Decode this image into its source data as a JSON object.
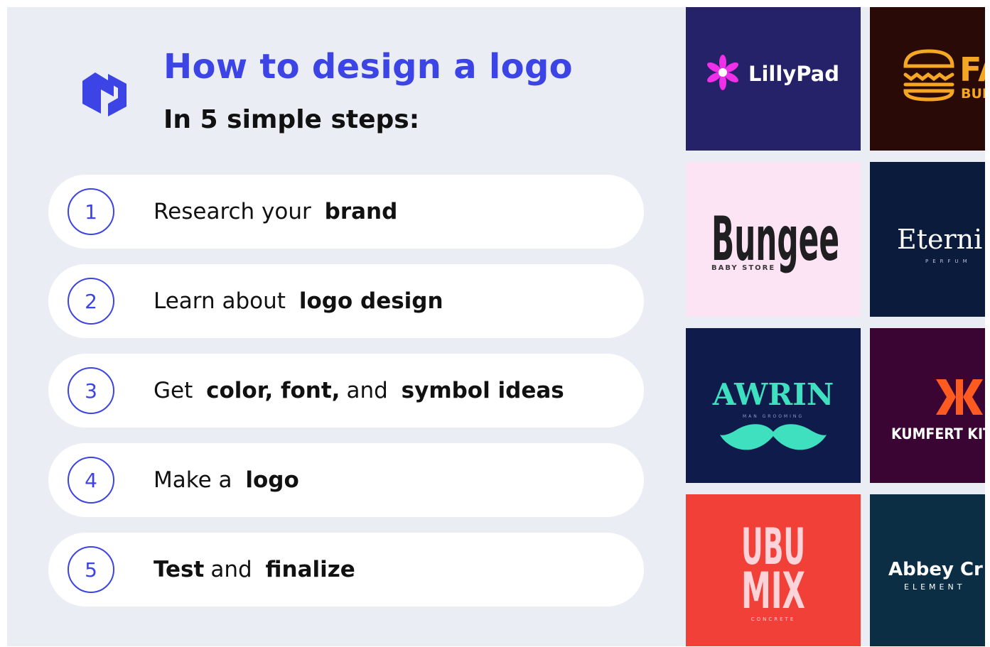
{
  "heading": {
    "title": "How to design a logo",
    "subtitle": "In 5 simple steps:"
  },
  "brand_icon": "hexagon-logo-icon",
  "steps": [
    {
      "number": "1",
      "parts": [
        "Research your",
        "brand"
      ]
    },
    {
      "number": "2",
      "parts": [
        "Learn about",
        "logo design"
      ]
    },
    {
      "number": "3",
      "parts": [
        "Get",
        "color, font,",
        "and",
        "symbol ideas"
      ]
    },
    {
      "number": "4",
      "parts": [
        "Make a",
        "logo"
      ]
    },
    {
      "number": "5",
      "parts": [
        "Test",
        "and",
        "finalize"
      ]
    }
  ],
  "logo_examples": {
    "lillypad": {
      "name": "LillyPad",
      "icon": "flower-icon"
    },
    "burger": {
      "name": "FA",
      "tagline": "BUR",
      "icon": "burger-icon"
    },
    "bungee": {
      "name": "Bungee",
      "tagline": "BABY STORE"
    },
    "eterni": {
      "name": "Eterni",
      "tagline": "PERFUM"
    },
    "awrin": {
      "name": "AWRIN",
      "tagline": "MAN GROOMING",
      "icon": "mustache-icon"
    },
    "kumfert": {
      "name": "KUMFERT KIT",
      "icon": "kumfert-k-mark-icon"
    },
    "ubumix": {
      "line1": "UBU",
      "line2": "MIX",
      "tagline": "CONCRETE"
    },
    "abbey": {
      "name": "Abbey Cr",
      "tagline": "ELEMENT"
    }
  },
  "colors": {
    "accent": "#3c44e6",
    "background": "#eaeef4",
    "lillypad_bg": "#25226a",
    "burger_bg": "#2a0a07",
    "bungee_bg": "#fde4f5",
    "eterni_bg": "#0a1b3c",
    "awrin_bg": "#0e1b4b",
    "kumfert_bg": "#3a0433",
    "ubumix_bg": "#f04038",
    "abbey_bg": "#0b2e45"
  }
}
